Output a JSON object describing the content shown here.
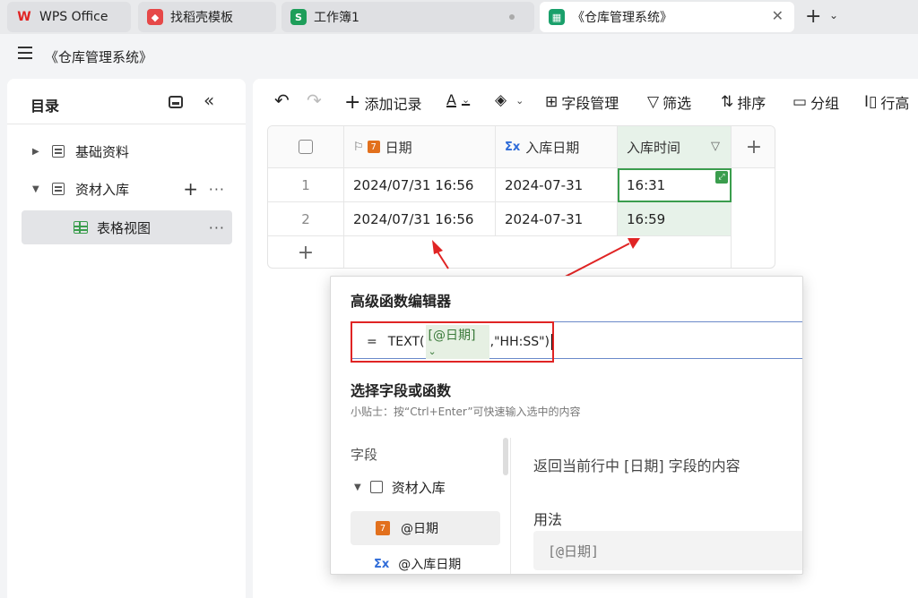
{
  "tabs": [
    {
      "label": "WPS Office",
      "icon": "wps-logo-icon"
    },
    {
      "label": "找稻壳模板",
      "icon": "docer-icon"
    },
    {
      "label": "工作簿1",
      "icon": "spreadsheet-icon"
    },
    {
      "label": "《仓库管理系统》",
      "icon": "smart-table-icon"
    }
  ],
  "app": {
    "title": "《仓库管理系统》"
  },
  "sidebar": {
    "title": "目录",
    "items": [
      {
        "label": "基础资料"
      },
      {
        "label": "资材入库"
      },
      {
        "label": "表格视图"
      }
    ]
  },
  "toolbar": {
    "add_record": "添加记录",
    "text_color": "A",
    "field_manage": "字段管理",
    "filter": "筛选",
    "sort": "排序",
    "group": "分组",
    "row_height": "行高"
  },
  "grid": {
    "columns": [
      "日期",
      "入库日期",
      "入库时间"
    ],
    "rows": [
      {
        "num": "1",
        "date": "2024/07/31 16:56",
        "in_date": "2024-07-31",
        "in_time": "16:31"
      },
      {
        "num": "2",
        "date": "2024/07/31 16:56",
        "in_date": "2024-07-31",
        "in_time": "16:59"
      }
    ]
  },
  "dialog": {
    "title": "高级函数编辑器",
    "formula": {
      "eq": "=",
      "fn_open": "TEXT(",
      "token": "[@日期]",
      "rest": ",\"HH:SS\")"
    },
    "section_title": "选择字段或函数",
    "tip": "小贴士：按“Ctrl+Enter”可快速输入选中的内容",
    "fields_header": "字段",
    "group": "资材入库",
    "field1": "@日期",
    "field2": "@入库日期",
    "description": "返回当前行中 [日期] 字段的内容",
    "usage_label": "用法",
    "usage_example": "[@日期]"
  },
  "colors": {
    "accent": "#3a9d4d",
    "highlight_red": "#e02424",
    "date_icon": "#e2701d"
  }
}
